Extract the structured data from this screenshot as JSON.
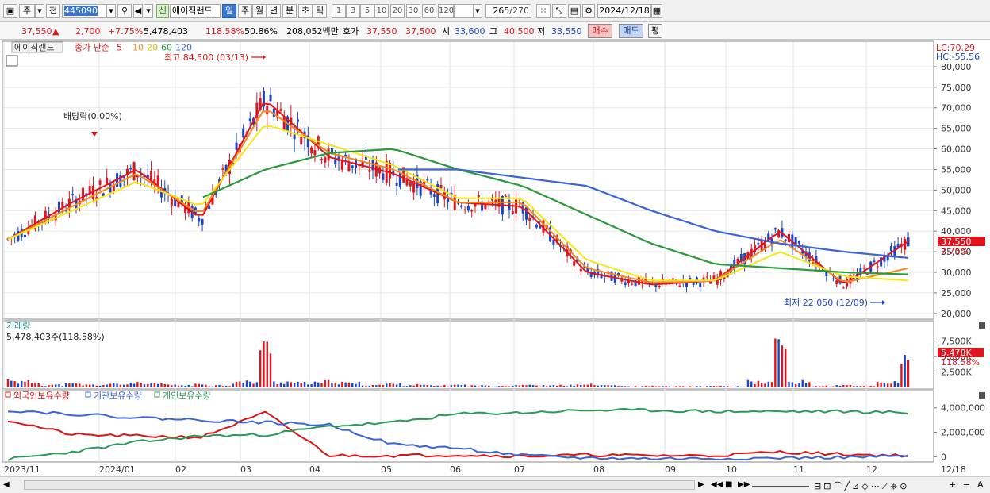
{
  "toolbar": {
    "market_mode": "주",
    "period_mode": "전",
    "code": "445090",
    "sin_label": "신",
    "stock_name": "에이직랜드",
    "period_tabs": [
      "일",
      "주",
      "월",
      "년",
      "분",
      "초",
      "틱"
    ],
    "active_period": "일",
    "minute_values": [
      "1",
      "3",
      "5",
      "10",
      "20",
      "30",
      "60",
      "120"
    ],
    "count": "265",
    "count_total": "/270",
    "date": "2024/12/18"
  },
  "quote": {
    "price": "37,550",
    "change_arrow": "▲",
    "change": "2,700",
    "change_pct": "+7.75%",
    "volume": "5,478,403",
    "volume_ratio": "118.58%",
    "turnover": "50.86%",
    "amount": "208,052백만",
    "hoga_label": "호가",
    "ask": "37,550",
    "bid": "37,500",
    "open_label": "시",
    "open": "33,600",
    "high_label": "고",
    "high": "40,500",
    "low_label": "저",
    "low": "33,550",
    "buy_label": "매수",
    "sell_label": "매도",
    "pyeong_label": "평"
  },
  "price_panel": {
    "stock_label": "에이직랜드",
    "ma_label": "종가 단순",
    "ma_periods": [
      "5",
      "10",
      "20",
      "60",
      "120"
    ],
    "lc_label": "LC:70.29",
    "hc_label": "HC:-55.56",
    "high_annotation": "최고 84,500 (03/13)",
    "low_annotation": "최저 22,050 (12/09)",
    "dividend_annotation": "배당락(0.00%)",
    "last_price_tag": "37,550",
    "last_pct_tag": "7.75%"
  },
  "volume_panel": {
    "title": "거래량",
    "subtitle": "5,478,403주(118.58%)",
    "last_tag": "5,478K",
    "last_pct_tag": "118.58%"
  },
  "holdings_panel": {
    "legend": [
      "외국인보유수량",
      "기관보유수량",
      "개인보유수량"
    ]
  },
  "x_axis": {
    "labels": [
      "2023/11",
      "2024/01",
      "02",
      "03",
      "04",
      "05",
      "06",
      "07",
      "08",
      "09",
      "10",
      "11",
      "12",
      "12/18"
    ]
  },
  "colors": {
    "up": "#e0141e",
    "down": "#1a45c8",
    "ma5": "#e0141e",
    "ma10": "#f08a1e",
    "ma20": "#f5e614",
    "ma60": "#2a9a3a",
    "ma120": "#3a64d8",
    "foreign": "#d81414",
    "institution": "#3a64d8",
    "individual": "#2a9a5a"
  },
  "chart_data": [
    {
      "type": "line",
      "title": "에이직랜드",
      "y_axis_labels": [
        "80,000",
        "75,000",
        "70,000",
        "65,000",
        "60,000",
        "55,000",
        "50,000",
        "45,000",
        "40,000",
        "35,000",
        "30,000",
        "25,000",
        "20,000"
      ],
      "ylim": [
        19000,
        85000
      ],
      "x": [
        "2023/11",
        "2023/12",
        "2024/01",
        "02",
        "03",
        "04",
        "05",
        "06",
        "07",
        "08",
        "09",
        "10",
        "11",
        "12",
        "12/18"
      ],
      "series": [
        {
          "name": "5",
          "values": [
            38000,
            47000,
            55000,
            43000,
            72000,
            58000,
            54000,
            47000,
            46000,
            30000,
            27000,
            28000,
            40000,
            27000,
            37550
          ]
        },
        {
          "name": "10",
          "values": [
            38000,
            46000,
            54000,
            44000,
            70000,
            59000,
            55000,
            47000,
            47000,
            31000,
            27500,
            28000,
            38000,
            27500,
            31000
          ]
        },
        {
          "name": "20",
          "values": [
            38000,
            45000,
            52000,
            46000,
            66000,
            61000,
            56000,
            48000,
            48000,
            33000,
            28000,
            28000,
            35000,
            29000,
            28000
          ]
        },
        {
          "name": "60",
          "values": [
            null,
            null,
            null,
            48000,
            55000,
            59000,
            60000,
            55000,
            51000,
            44000,
            37000,
            32000,
            31000,
            30000,
            29500
          ]
        },
        {
          "name": "120",
          "values": [
            null,
            null,
            null,
            null,
            null,
            null,
            55000,
            55000,
            53000,
            51000,
            45000,
            40000,
            37000,
            35000,
            33500
          ]
        }
      ]
    },
    {
      "type": "bar",
      "title": "거래량",
      "y_axis_labels": [
        "7,500K",
        "5,000K",
        "2,500K"
      ],
      "ylim": [
        0,
        9000000
      ],
      "categories": [
        "2023/11",
        "2023/12",
        "2024/01",
        "02",
        "03",
        "04",
        "05",
        "06",
        "07",
        "08",
        "09",
        "10",
        "11",
        "12",
        "12/18"
      ],
      "values": [
        1500000,
        700000,
        900000,
        600000,
        8000000,
        1200000,
        700000,
        500000,
        500000,
        600000,
        300000,
        300000,
        8500000,
        400000,
        5478403
      ]
    },
    {
      "type": "line",
      "title": "보유수량",
      "y_axis_labels": [
        "4,000,000",
        "2,000,000",
        "0"
      ],
      "ylim": [
        -300000,
        4500000
      ],
      "x": [
        "2023/11",
        "2023/12",
        "2024/01",
        "02",
        "03",
        "04",
        "05",
        "06",
        "07",
        "08",
        "09",
        "10",
        "11",
        "12",
        "12/18"
      ],
      "series": [
        {
          "name": "외국인보유수량",
          "values": [
            3000000,
            1800000,
            1700000,
            1600000,
            3600000,
            100000,
            100000,
            150000,
            50000,
            150000,
            100000,
            100000,
            400000,
            200000,
            100000
          ]
        },
        {
          "name": "기관보유수량",
          "values": [
            3800000,
            3500000,
            3200000,
            3000000,
            2800000,
            2600000,
            1000000,
            700000,
            100000,
            -100000,
            -150000,
            -150000,
            -100000,
            -50000,
            50000
          ]
        },
        {
          "name": "개인보유수량",
          "values": [
            -200000,
            400000,
            1200000,
            1700000,
            1800000,
            2500000,
            2800000,
            3500000,
            3600000,
            3800000,
            3800000,
            3700000,
            3700000,
            3700000,
            3600000
          ]
        }
      ]
    }
  ]
}
